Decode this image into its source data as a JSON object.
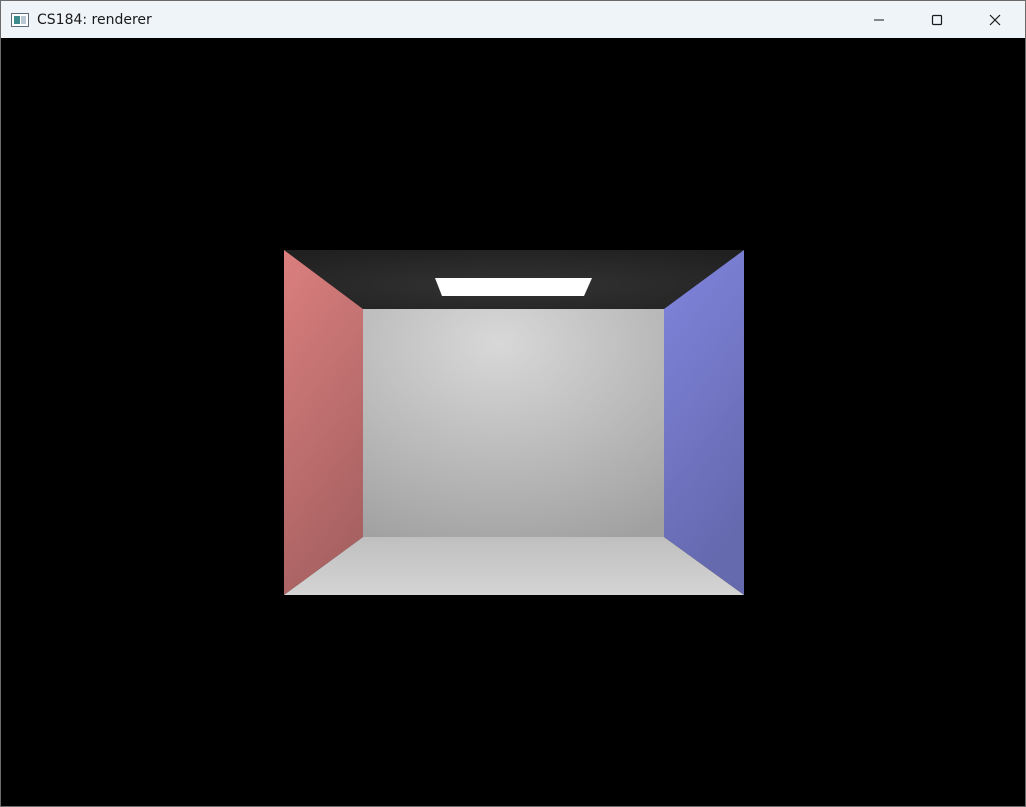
{
  "window": {
    "title": "CS184: renderer"
  },
  "icons": {
    "app": "app-window-icon",
    "minimize": "minimize-icon",
    "maximize": "maximize-icon",
    "close": "close-icon"
  },
  "scene": {
    "type": "cornell-box",
    "colors": {
      "background": "#000000",
      "left_wall": "#c77373",
      "right_wall": "#7377c6",
      "back_wall": "#c4c4c4",
      "ceiling": "#202020",
      "floor": "#d0d0d0",
      "light": "#ffffff"
    }
  }
}
